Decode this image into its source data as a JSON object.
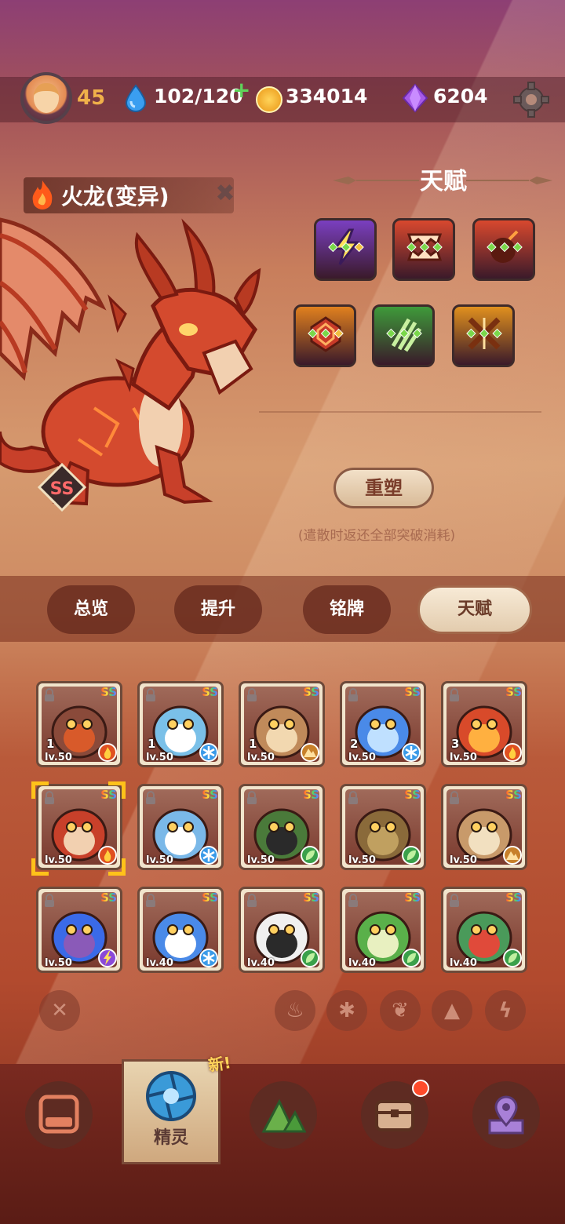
{
  "top_bar": {
    "level": "45",
    "energy": "102/120",
    "coins": "334014",
    "gems": "6204"
  },
  "pet": {
    "name": "火龙(变异)",
    "rank": "SS"
  },
  "talent": {
    "title": "天赋",
    "reset_label": "重塑",
    "note": "(遣散时返还全部突破消耗)",
    "tiles": [
      {
        "icon": "lightning-icon",
        "color": "#7a3fc0"
      },
      {
        "icon": "fangs-icon",
        "color": "#d8482e"
      },
      {
        "icon": "bomb-icon",
        "color": "#d8482e"
      },
      {
        "icon": "crystal-icon",
        "color": "#e0801e"
      },
      {
        "icon": "claw-icon",
        "color": "#3e9a3a"
      },
      {
        "icon": "cross-slash-icon",
        "color": "#e0901e"
      }
    ]
  },
  "tabs": [
    {
      "label": "总览"
    },
    {
      "label": "提升"
    },
    {
      "label": "铭牌"
    },
    {
      "label": "天赋"
    }
  ],
  "pets": [
    {
      "rank": "SS",
      "level": "lv.50",
      "stars": "1",
      "element": "fire-icon"
    },
    {
      "rank": "SS",
      "level": "lv.50",
      "stars": "1",
      "element": "ice-icon"
    },
    {
      "rank": "SS",
      "level": "lv.50",
      "stars": "1",
      "element": "earth-icon"
    },
    {
      "rank": "SS",
      "level": "lv.50",
      "stars": "2",
      "element": "ice-icon"
    },
    {
      "rank": "SS",
      "level": "lv.50",
      "stars": "3",
      "element": "fire-icon"
    },
    {
      "rank": "SS",
      "level": "lv.50",
      "stars": "",
      "element": "fire-icon"
    },
    {
      "rank": "SS",
      "level": "lv.50",
      "stars": "",
      "element": "ice-icon"
    },
    {
      "rank": "SS",
      "level": "lv.50",
      "stars": "",
      "element": "leaf-icon"
    },
    {
      "rank": "SS",
      "level": "lv.50",
      "stars": "",
      "element": "leaf-icon"
    },
    {
      "rank": "SS",
      "level": "lv.50",
      "stars": "",
      "element": "earth-icon"
    },
    {
      "rank": "SS",
      "level": "lv.50",
      "stars": "",
      "element": "lightning-icon"
    },
    {
      "rank": "SS",
      "level": "lv.40",
      "stars": "",
      "element": "ice-icon"
    },
    {
      "rank": "SS",
      "level": "lv.40",
      "stars": "",
      "element": "leaf-icon"
    },
    {
      "rank": "SS",
      "level": "lv.40",
      "stars": "",
      "element": "leaf-icon"
    },
    {
      "rank": "SS",
      "level": "lv.40",
      "stars": "",
      "element": "leaf-icon"
    }
  ],
  "filters": [
    "close-filter-icon",
    "fire-filter-icon",
    "ice-filter-icon",
    "leaf-filter-icon",
    "earth-filter-icon",
    "lightning-filter-icon"
  ],
  "nav": {
    "active_label": "精灵",
    "new_tag": "新!"
  },
  "colors": {
    "ss_gradient": "#ff4040",
    "accent": "#f0b04a"
  }
}
